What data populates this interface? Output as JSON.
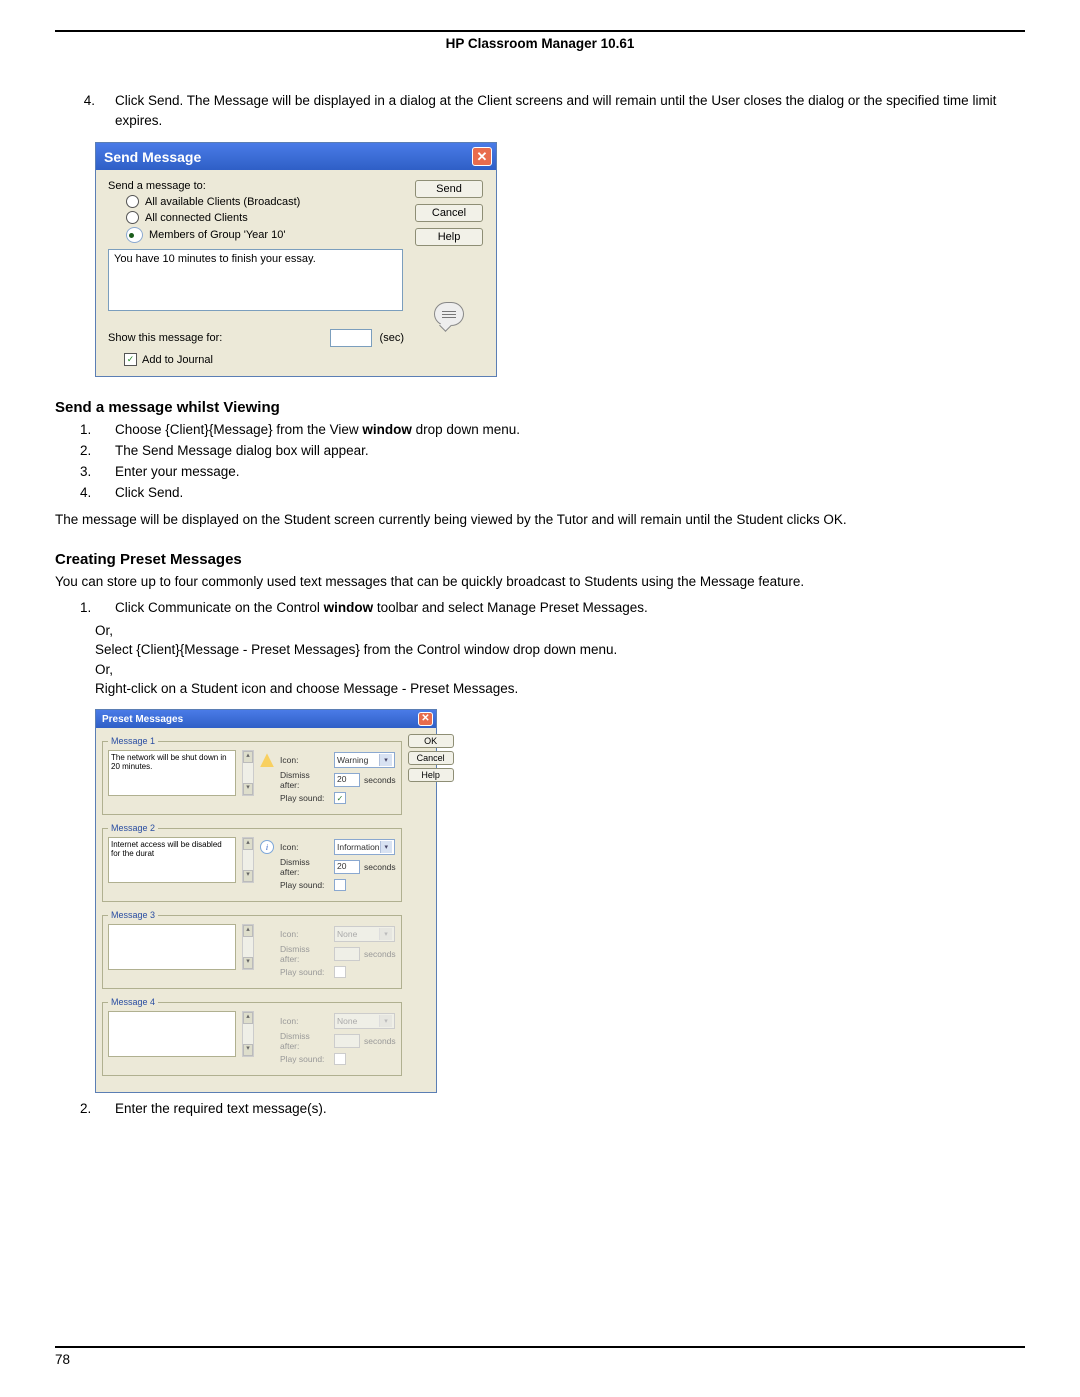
{
  "doc_header": "HP Classroom Manager 10.61",
  "page_number": "78",
  "para4_num": "4.",
  "para4_text_a": "Click Send. The Message will be displayed in a dialog at the Client screens and will remain until the User closes the dialog or the specified time limit expires.",
  "dlg1": {
    "title": "Send Message",
    "sendto": "Send a message to:",
    "opt1": "All available Clients (Broadcast)",
    "opt2": "All connected Clients",
    "opt3": "Members of Group 'Year 10'",
    "msgtext": "You have 10 minutes to finish your essay.",
    "show_for": "Show this message for:",
    "sec": "(sec)",
    "add_journal": "Add to Journal",
    "btn_send": "Send",
    "btn_cancel": "Cancel",
    "btn_help": "Help"
  },
  "heading1": "Send a message whilst Viewing",
  "list1": {
    "i1a": "Choose {Client}{Message} from the View ",
    "i1b": "window",
    "i1c": " drop down menu.",
    "i2": "The Send Message dialog box will appear.",
    "i3": "Enter your message.",
    "i4": "Click Send."
  },
  "para_after1": "The message will be displayed on the Student screen currently being viewed by the Tutor and will remain until the Student clicks OK.",
  "heading2": "Creating Preset Messages",
  "para_after2": "You can store up to four commonly used text messages that can be quickly broadcast to Students using the Message feature.",
  "list2": {
    "i1a": "Click Communicate on the Control ",
    "i1b": "window",
    "i1c": " toolbar and select Manage Preset Messages.",
    "or": "Or,",
    "i1d": "Select {Client}{Message - Preset Messages} from the Control window drop down menu.",
    "i1e": "Right-click on a Student icon and choose Message - Preset Messages."
  },
  "dlg2": {
    "title": "Preset Messages",
    "btn_ok": "OK",
    "btn_cancel": "Cancel",
    "btn_help": "Help",
    "lbl_icon": "Icon:",
    "lbl_dismiss": "Dismiss after:",
    "lbl_play": "Play sound:",
    "seconds": "seconds",
    "m1": {
      "title": "Message 1",
      "text": "The network will be shut down in 20 minutes.",
      "icon": "Warning",
      "dismiss": "20",
      "play_checked": true
    },
    "m2": {
      "title": "Message 2",
      "text": "Internet access will be disabled for the durat",
      "icon": "Information",
      "dismiss": "20",
      "play_checked": false
    },
    "m3": {
      "title": "Message 3",
      "text": "",
      "icon": "None",
      "dismiss": "",
      "play_checked": false
    },
    "m4": {
      "title": "Message 4",
      "text": "",
      "icon": "None",
      "dismiss": "",
      "play_checked": false
    }
  },
  "list2_i2": "Enter the required text message(s)."
}
